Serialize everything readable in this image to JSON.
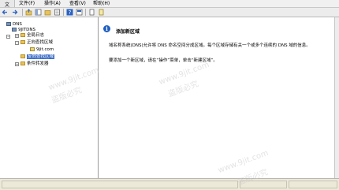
{
  "menubar": {
    "stub": "文",
    "items": [
      "文件(F)",
      "操作(A)",
      "查看(V)",
      "帮助(H)"
    ]
  },
  "tree": {
    "root": "DNS",
    "server": "9JITDNS",
    "global_log": "全局日志",
    "forward_zones": "正向查找区域",
    "zone_9jit": "9jit.com",
    "reverse_zones": "反向查找区域",
    "conditional_forwarders": "条件转发器"
  },
  "content": {
    "title": "添加新区域",
    "para1": "域名称系统(DNS)允许将 DNS 命名空间分成区域。每个区域存储有关一个或多个连续的 DNS 域的信息。",
    "para2": "要添加一个新区域，请在“操作”菜单，单击“新建区域”。"
  },
  "watermarks": [
    "www.9jit.com",
    "盗版必究",
    "www.9jit.com",
    "盗版必究",
    "www.9jit.com",
    "盗版必究"
  ],
  "colors": {
    "selection": "#3b6cc8",
    "info_icon": "#1f5fc0"
  }
}
